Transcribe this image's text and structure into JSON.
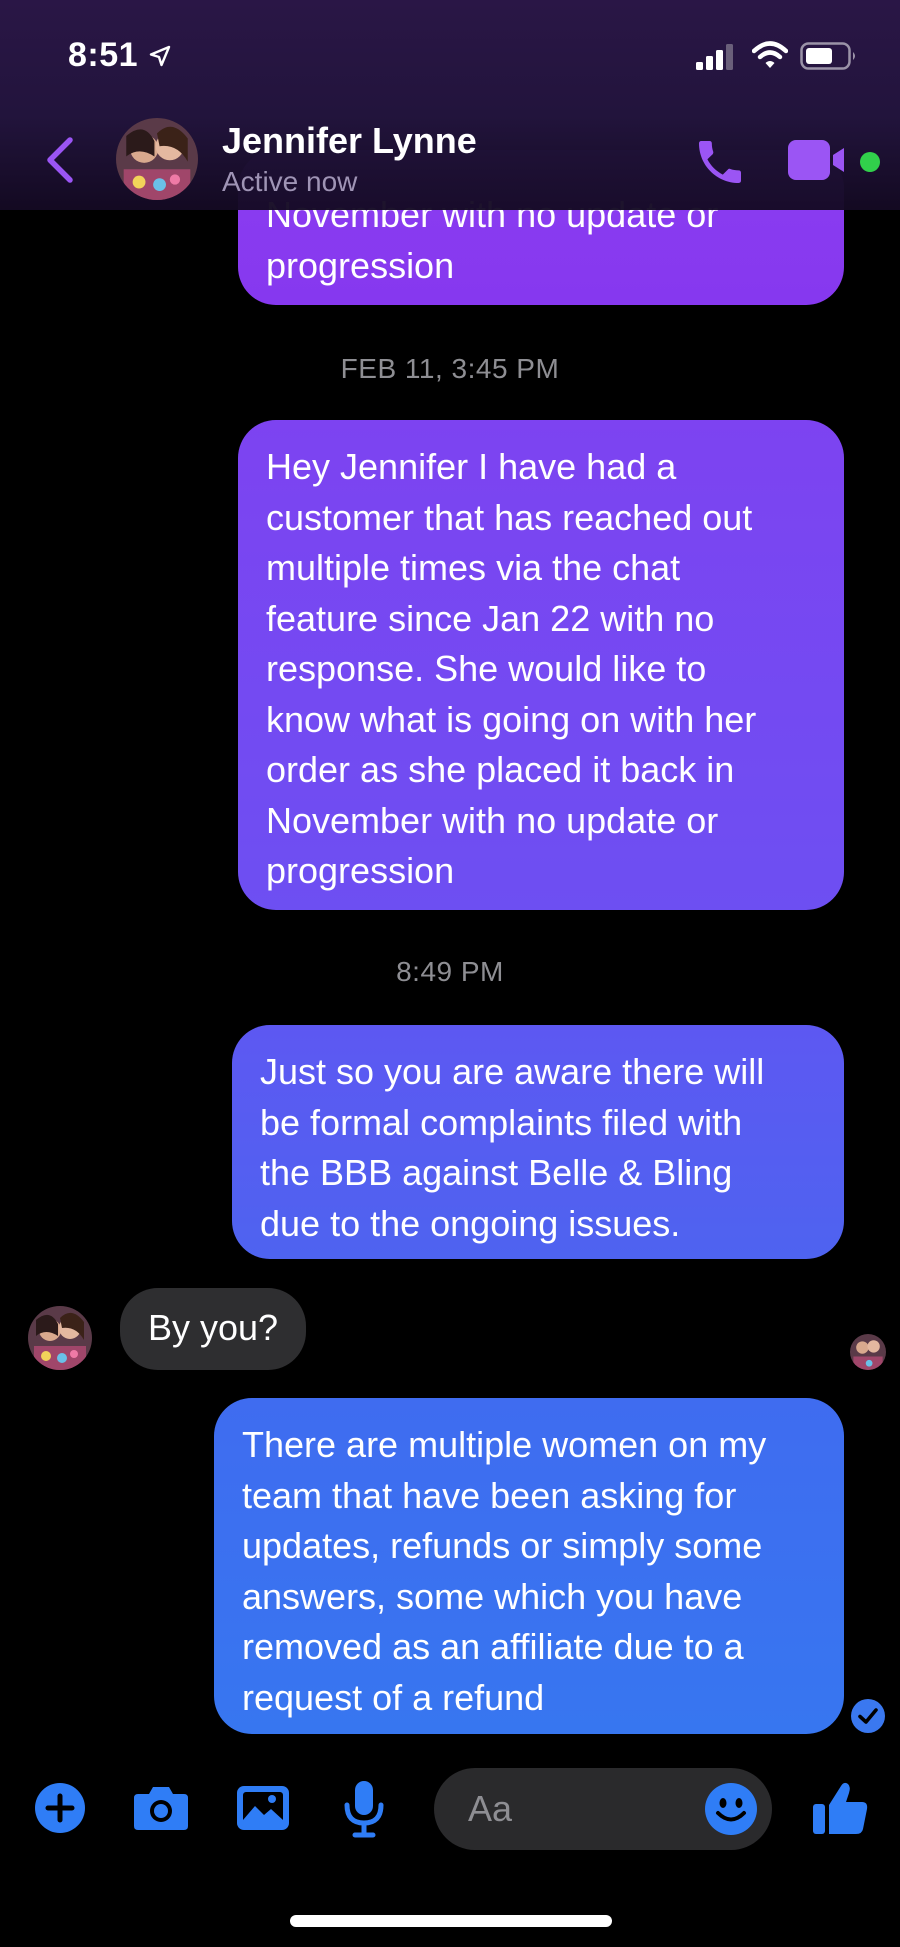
{
  "status_bar": {
    "time": "8:51"
  },
  "header": {
    "contact_name": "Jennifer Lynne",
    "contact_status": "Active now"
  },
  "colors": {
    "accent": "#8b5cf6",
    "outgoing_top": "#8b3df0",
    "outgoing_bottom": "#3776f0",
    "incoming_bubble": "#2e2e30",
    "active_dot": "#31d04b",
    "composer_icons": "#2f7df6"
  },
  "messages": [
    {
      "direction": "outgoing",
      "text": "November with no update or\nprogression"
    },
    {
      "type": "timestamp",
      "text": "FEB 11, 3:45 PM"
    },
    {
      "direction": "outgoing",
      "text": "Hey Jennifer I have had a\ncustomer that has reached out\nmultiple times via the chat\nfeature since Jan 22 with no\nresponse. She would like to\nknow what is going on with her\norder as she placed it back in\nNovember with no update or\nprogression"
    },
    {
      "type": "timestamp",
      "text": "8:49 PM"
    },
    {
      "direction": "outgoing",
      "text": "Just so you are aware there will\nbe formal complaints filed with\nthe BBB against Belle & Bling\ndue to the ongoing issues."
    },
    {
      "direction": "incoming",
      "text": "By you?"
    },
    {
      "direction": "outgoing",
      "text": "There are multiple women on my\nteam that have been asking for\nupdates, refunds or simply some\nanswers, some which you have\nremoved as an affiliate due to a\nrequest of a refund"
    }
  ],
  "composer": {
    "placeholder": "Aa"
  },
  "icons": {
    "back": "chevron-left-icon",
    "call": "phone-icon",
    "video": "video-camera-icon",
    "plus": "plus-icon",
    "camera": "camera-icon",
    "gallery": "image-icon",
    "mic": "microphone-icon",
    "emoji": "smiley-icon",
    "like": "thumbs-up-icon",
    "delivered": "check-circle-icon"
  }
}
